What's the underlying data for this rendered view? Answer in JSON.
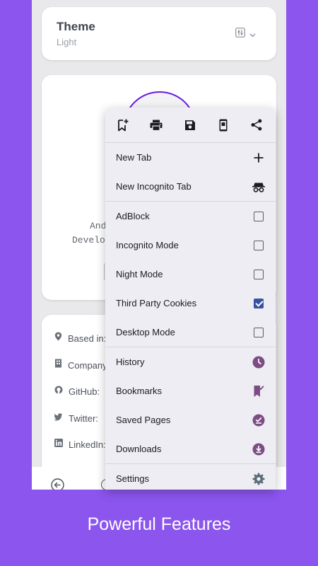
{
  "settings": {
    "theme_title": "Theme",
    "theme_value": "Light"
  },
  "profile": {
    "line1": "And",
    "line2": "Develo"
  },
  "info": {
    "based_in": "Based in:",
    "company": "Company",
    "github": "GitHub:",
    "twitter": "Twitter:",
    "linkedin": "LinkedIn:"
  },
  "menu": {
    "toolbar_icons": [
      "bookmark-add-icon",
      "print-icon",
      "save-icon",
      "phone-icon",
      "share-icon"
    ],
    "new_tab": "New Tab",
    "new_incognito_tab": "New Incognito Tab",
    "adblock": "AdBlock",
    "incognito_mode": "Incognito Mode",
    "night_mode": "Night Mode",
    "third_party_cookies": "Third Party Cookies",
    "desktop_mode": "Desktop Mode",
    "history": "History",
    "bookmarks": "Bookmarks",
    "saved_pages": "Saved Pages",
    "downloads": "Downloads",
    "settings": "Settings",
    "toggles": {
      "adblock": false,
      "incognito_mode": false,
      "night_mode": false,
      "third_party_cookies": true,
      "desktop_mode": false
    }
  },
  "caption": "Powerful Features",
  "colors": {
    "background": "#8b55ee",
    "accent": "#6a1be0",
    "menu_icon": "#7b4d84",
    "checkbox_checked": "#3553a1"
  }
}
